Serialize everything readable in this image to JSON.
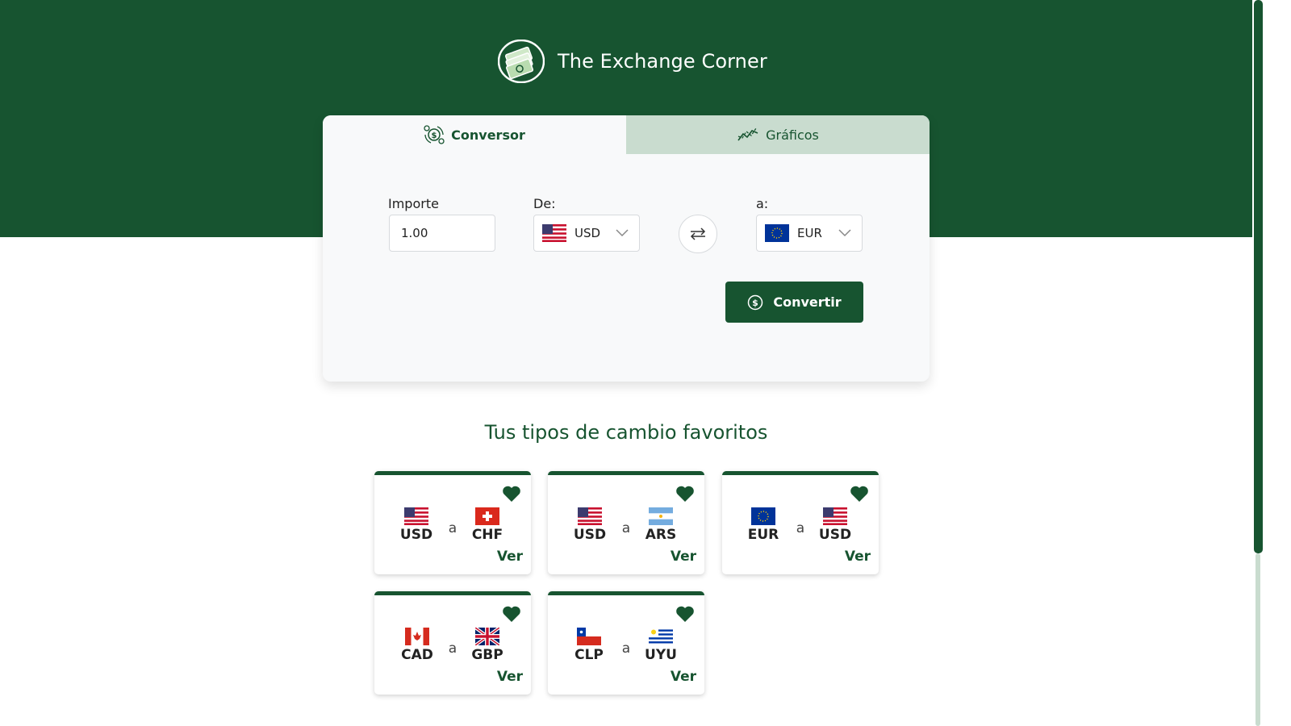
{
  "brand": {
    "title": "The Exchange Corner",
    "logo_icon": "money-bills-icon"
  },
  "tabs": [
    {
      "label": "Conversor",
      "icon": "coins-exchange-icon",
      "active": true
    },
    {
      "label": "Gráficos",
      "icon": "line-chart-icon",
      "active": false
    }
  ],
  "converter": {
    "amount_label": "Importe",
    "amount_value": "1.00",
    "from_label": "De:",
    "from_currency": "USD",
    "from_flag": "us-flag-icon",
    "to_label": "a:",
    "to_currency": "EUR",
    "to_flag": "eu-flag-icon",
    "swap_icon": "swap-arrows-icon",
    "convert_label": "Convertir",
    "convert_icon": "dollar-coin-icon"
  },
  "favorites": {
    "title": "Tus tipos de cambio favoritos",
    "connector": "a",
    "view_label": "Ver",
    "items": [
      {
        "from": "USD",
        "to": "CHF"
      },
      {
        "from": "USD",
        "to": "ARS"
      },
      {
        "from": "EUR",
        "to": "USD"
      },
      {
        "from": "CAD",
        "to": "GBP"
      },
      {
        "from": "CLP",
        "to": "UYU"
      }
    ]
  },
  "colors": {
    "primary": "#175430",
    "tab_inactive": "#c9dccf",
    "card_bg": "#f8f9fa"
  }
}
